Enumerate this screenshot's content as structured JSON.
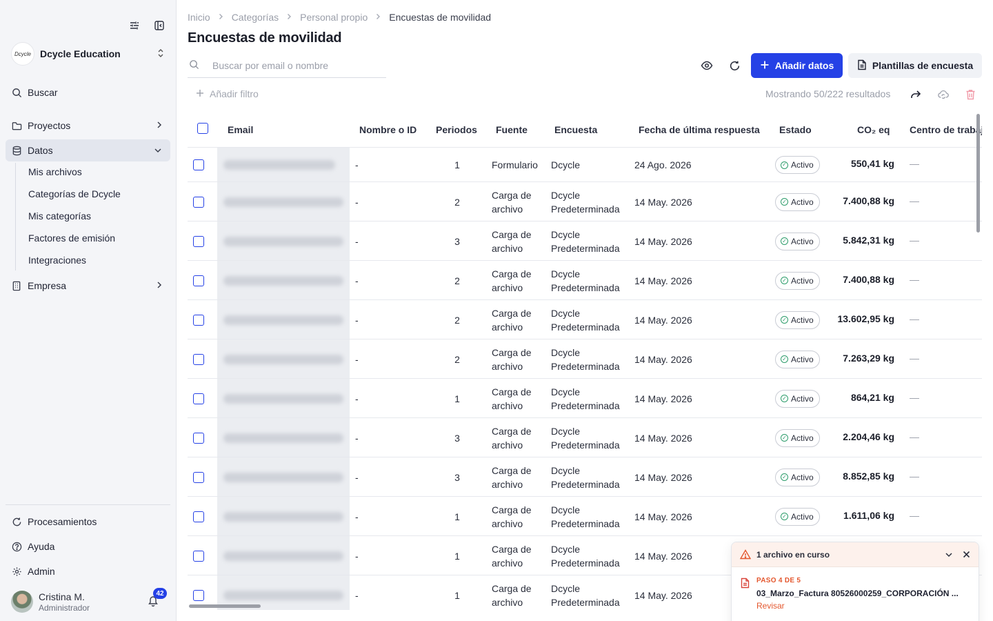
{
  "sidebar": {
    "org_logo": "Dcycle",
    "org_name": "Dcycle Education",
    "search_label": "Buscar",
    "nav": {
      "proyectos": "Proyectos",
      "datos": "Datos",
      "empresa": "Empresa"
    },
    "datos_sub": [
      "Mis archivos",
      "Categorías de Dcycle",
      "Mis categorías",
      "Factores de emisión",
      "Integraciones"
    ],
    "bottom": {
      "procesamientos": "Procesamientos",
      "ayuda": "Ayuda",
      "admin": "Admin"
    },
    "user": {
      "name": "Cristina M.",
      "role": "Administrador",
      "notifications": "42"
    }
  },
  "breadcrumb": [
    "Inicio",
    "Categorías",
    "Personal propio",
    "Encuestas de movilidad"
  ],
  "page_title": "Encuestas de movilidad",
  "search": {
    "placeholder": "Buscar por email o nombre"
  },
  "toolbar": {
    "add_data": "Añadir datos",
    "templates": "Plantillas de encuesta",
    "add_filter": "Añadir filtro",
    "results": "Mostrando 50/222 resultados"
  },
  "table": {
    "headers": {
      "email": "Email",
      "name": "Nombre o ID",
      "periods": "Periodos",
      "source": "Fuente",
      "survey": "Encuesta",
      "date": "Fecha de última respuesta",
      "status": "Estado",
      "co2": "CO₂ eq",
      "center": "Centro de trabajo"
    },
    "rows": [
      {
        "name": "-",
        "periods": "1",
        "source": "Formulario",
        "survey": "Dcycle",
        "date": "24 Ago. 2026",
        "status": "Activo",
        "co2": "550,41 kg",
        "center": "—"
      },
      {
        "name": "-",
        "periods": "2",
        "source": "Carga de archivo",
        "survey": "Dcycle Predeterminada",
        "date": "14 May. 2026",
        "status": "Activo",
        "co2": "7.400,88 kg",
        "center": "—"
      },
      {
        "name": "-",
        "periods": "3",
        "source": "Carga de archivo",
        "survey": "Dcycle Predeterminada",
        "date": "14 May. 2026",
        "status": "Activo",
        "co2": "5.842,31 kg",
        "center": "—"
      },
      {
        "name": "-",
        "periods": "2",
        "source": "Carga de archivo",
        "survey": "Dcycle Predeterminada",
        "date": "14 May. 2026",
        "status": "Activo",
        "co2": "7.400,88 kg",
        "center": "—"
      },
      {
        "name": "-",
        "periods": "2",
        "source": "Carga de archivo",
        "survey": "Dcycle Predeterminada",
        "date": "14 May. 2026",
        "status": "Activo",
        "co2": "13.602,95 kg",
        "center": "—"
      },
      {
        "name": "-",
        "periods": "2",
        "source": "Carga de archivo",
        "survey": "Dcycle Predeterminada",
        "date": "14 May. 2026",
        "status": "Activo",
        "co2": "7.263,29 kg",
        "center": "—"
      },
      {
        "name": "-",
        "periods": "1",
        "source": "Carga de archivo",
        "survey": "Dcycle Predeterminada",
        "date": "14 May. 2026",
        "status": "Activo",
        "co2": "864,21 kg",
        "center": "—"
      },
      {
        "name": "-",
        "periods": "3",
        "source": "Carga de archivo",
        "survey": "Dcycle Predeterminada",
        "date": "14 May. 2026",
        "status": "Activo",
        "co2": "2.204,46 kg",
        "center": "—"
      },
      {
        "name": "-",
        "periods": "3",
        "source": "Carga de archivo",
        "survey": "Dcycle Predeterminada",
        "date": "14 May. 2026",
        "status": "Activo",
        "co2": "8.852,85 kg",
        "center": "—"
      },
      {
        "name": "-",
        "periods": "1",
        "source": "Carga de archivo",
        "survey": "Dcycle Predeterminada",
        "date": "14 May. 2026",
        "status": "Activo",
        "co2": "1.611,06 kg",
        "center": "—"
      },
      {
        "name": "-",
        "periods": "1",
        "source": "Carga de archivo",
        "survey": "Dcycle Predeterminada",
        "date": "14 May. 2026",
        "status": "",
        "co2": "",
        "center": ""
      },
      {
        "name": "-",
        "periods": "1",
        "source": "Carga de archivo",
        "survey": "Dcycle Predeterminada",
        "date": "14 May. 2026",
        "status": "",
        "co2": "",
        "center": ""
      }
    ]
  },
  "toast": {
    "title": "1 archivo en curso",
    "step": "PASO 4 DE 5",
    "file": "03_Marzo_Factura 80526000259_CORPORACIÓN ...",
    "action": "Revisar"
  },
  "colors": {
    "primary": "#2541e6",
    "warning": "#e4572e",
    "status_ok": "#2c9c6a"
  }
}
